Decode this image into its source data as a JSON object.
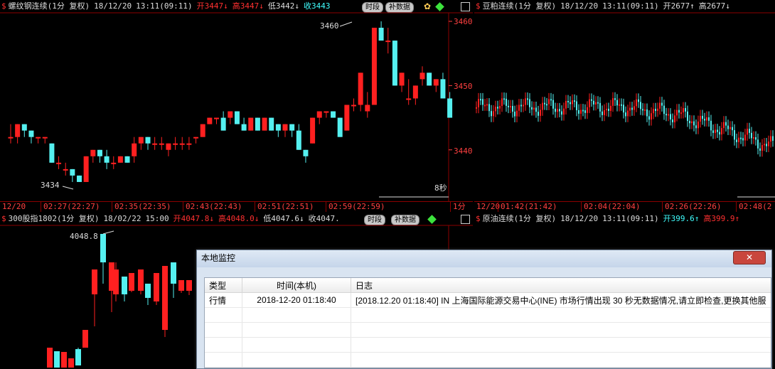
{
  "colors": {
    "up": "#ff2020",
    "down": "#55f0f0",
    "axis": "#8b0000",
    "label": "#ff4040"
  },
  "panel_tl": {
    "header": {
      "symbol": "螺纹钢连续(1分 复权)",
      "date": "18/12/20",
      "time": "13:11(09:11)",
      "open": "开3447↓",
      "high": "高3447↓",
      "low": "低3442↓",
      "close": "收3443"
    },
    "buttons": {
      "segment": "时段",
      "fill": "补数据"
    },
    "price_axis": [
      "3460",
      "3450",
      "3440"
    ],
    "hi_label": "3460",
    "lo_label": "3434",
    "sec_label": "8秒",
    "unit_label": "1分",
    "time_axis": [
      "12/20",
      "02:27(22:27)",
      "02:35(22:35)",
      "02:43(22:43)",
      "02:51(22:51)",
      "02:59(22:59)"
    ]
  },
  "panel_tr": {
    "header": {
      "symbol": "豆粕连续(1分 复权)",
      "date": "18/12/20",
      "time": "13:11(09:11)",
      "open": "开2677↑",
      "high": "高2677↓"
    },
    "time_axis": [
      "12/20",
      "01:42(21:42)",
      "02:04(22:04)",
      "02:26(22:26)",
      "02:48(2"
    ]
  },
  "panel_bl": {
    "header": {
      "symbol": "300股指1802(1分 复权)",
      "date": "18/02/22",
      "time": "15:00",
      "open": "开4047.8↓",
      "high": "高4048.0↓",
      "low": "低4047.6↓",
      "close": "收4047."
    },
    "buttons": {
      "segment": "时段",
      "fill": "补数据"
    },
    "hi_label": "4048.8"
  },
  "panel_br": {
    "header": {
      "symbol": "原油连续(1分 复权)",
      "date": "18/12/20",
      "time": "13:11(09:11)",
      "open": "开399.6↑",
      "high": "高399.9↑"
    }
  },
  "dialog": {
    "title": "本地监控",
    "close_label": "✕",
    "columns": [
      "类型",
      "时间(本机)",
      "日志"
    ],
    "rows": [
      {
        "type": "行情",
        "time": "2018-12-20 01:18:40",
        "log": "[2018.12.20 01:18:40] IN 上海国际能源交易中心(INE) 市场行情出现 30 秒无数据情况,请立即检查,更换其他服"
      }
    ]
  },
  "chart_data": [
    {
      "type": "candlestick",
      "title": "螺纹钢连续(1分 复权)",
      "ylim": [
        3434,
        3460
      ],
      "candles": [
        [
          3442,
          3444,
          3441,
          3442
        ],
        [
          3442,
          3444,
          3441,
          3444
        ],
        [
          3444,
          3444,
          3442,
          3443
        ],
        [
          3443,
          3443,
          3441,
          3442
        ],
        [
          3442,
          3442,
          3441,
          3442
        ],
        [
          3442,
          3442,
          3441,
          3442
        ],
        [
          3441,
          3441,
          3438,
          3438
        ],
        [
          3438,
          3439,
          3437,
          3438
        ],
        [
          3437,
          3438,
          3436,
          3437
        ],
        [
          3437,
          3437,
          3435,
          3436
        ],
        [
          3436,
          3436,
          3435,
          3435
        ],
        [
          3435,
          3439,
          3435,
          3439
        ],
        [
          3439,
          3440,
          3438,
          3440
        ],
        [
          3440,
          3440,
          3438,
          3439
        ],
        [
          3439,
          3440,
          3437,
          3438
        ],
        [
          3438,
          3439,
          3437,
          3438
        ],
        [
          3438,
          3439,
          3438,
          3439
        ],
        [
          3439,
          3439,
          3438,
          3438
        ],
        [
          3439,
          3442,
          3438,
          3441
        ],
        [
          3441,
          3442,
          3440,
          3442
        ],
        [
          3442,
          3442,
          3440,
          3441
        ],
        [
          3441,
          3442,
          3440,
          3441
        ],
        [
          3441,
          3442,
          3440,
          3441
        ],
        [
          3440,
          3441,
          3439,
          3441
        ],
        [
          3441,
          3442,
          3440,
          3441
        ],
        [
          3441,
          3442,
          3440,
          3441
        ],
        [
          3441,
          3442,
          3440,
          3441
        ],
        [
          3442,
          3442,
          3441,
          3442
        ],
        [
          3442,
          3444,
          3442,
          3444
        ],
        [
          3444,
          3445,
          3444,
          3445
        ],
        [
          3445,
          3445,
          3444,
          3445
        ],
        [
          3445,
          3446,
          3443,
          3443
        ],
        [
          3445,
          3446,
          3444,
          3446
        ],
        [
          3446,
          3446,
          3444,
          3444
        ],
        [
          3444,
          3445,
          3443,
          3443
        ],
        [
          3443,
          3445,
          3443,
          3445
        ],
        [
          3445,
          3445,
          3443,
          3443
        ],
        [
          3443,
          3445,
          3443,
          3445
        ],
        [
          3445,
          3445,
          3443,
          3443
        ],
        [
          3444,
          3444,
          3442,
          3443
        ],
        [
          3443,
          3444,
          3442,
          3444
        ],
        [
          3444,
          3444,
          3442,
          3443
        ],
        [
          3443,
          3444,
          3440,
          3440
        ],
        [
          3440,
          3440,
          3438,
          3439
        ],
        [
          3441,
          3445,
          3441,
          3445
        ],
        [
          3445,
          3446,
          3444,
          3446
        ],
        [
          3446,
          3446,
          3445,
          3446
        ],
        [
          3446,
          3446,
          3445,
          3445
        ],
        [
          3445,
          3445,
          3442,
          3442
        ],
        [
          3443,
          3447,
          3443,
          3447
        ],
        [
          3447,
          3448,
          3446,
          3447
        ],
        [
          3447,
          3452,
          3446,
          3452
        ],
        [
          3446,
          3449,
          3445,
          3447
        ],
        [
          3447,
          3459,
          3447,
          3459
        ],
        [
          3459,
          3460,
          3458,
          3457
        ],
        [
          3457,
          3459,
          3455,
          3457
        ],
        [
          3457,
          3457,
          3450,
          3450
        ],
        [
          3450,
          3452,
          3449,
          3452
        ],
        [
          3448,
          3451,
          3447,
          3448
        ],
        [
          3448,
          3450,
          3447,
          3450
        ],
        [
          3451,
          3453,
          3450,
          3452
        ],
        [
          3452,
          3452,
          3450,
          3450
        ],
        [
          3450,
          3451,
          3449,
          3451
        ],
        [
          3451,
          3452,
          3448,
          3448
        ],
        [
          3448,
          3449,
          3445,
          3445
        ]
      ]
    },
    {
      "type": "candlestick",
      "title": "豆粕连续(1分 复权)",
      "ylim": [
        2664,
        2692
      ]
    }
  ]
}
